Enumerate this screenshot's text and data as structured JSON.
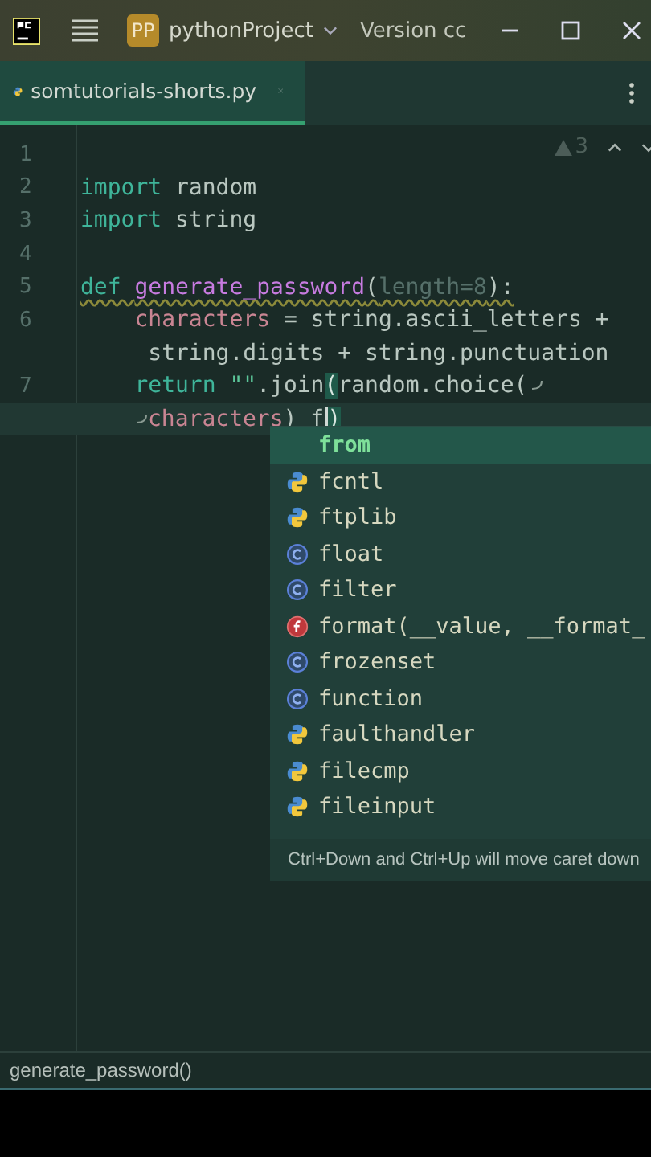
{
  "title_bar": {
    "project_badge": "PP",
    "project": "pythonProject",
    "vcs": "Version cc"
  },
  "tabs": [
    {
      "label": "somtutorials-shorts.py",
      "selected": true
    }
  ],
  "inspections": {
    "count": "3"
  },
  "code_lines": [
    {
      "number": "1"
    },
    {
      "number": "2",
      "segments": [
        {
          "kind": "keyword",
          "text": "import"
        },
        {
          "kind": "plain",
          "text": " random"
        }
      ]
    },
    {
      "number": "3",
      "segments": [
        {
          "kind": "keyword",
          "text": "import"
        },
        {
          "kind": "plain",
          "text": " string"
        }
      ]
    },
    {
      "number": "4"
    },
    {
      "number": "5",
      "warning": true,
      "segments": [
        {
          "kind": "keyword",
          "text": "def "
        },
        {
          "kind": "function",
          "text": "generate_password"
        },
        {
          "kind": "plain",
          "text": "("
        },
        {
          "kind": "param",
          "text": "length=8"
        },
        {
          "kind": "plain",
          "text": "):"
        }
      ]
    },
    {
      "number": "6",
      "segments": [
        {
          "kind": "variable",
          "text": "    characters"
        },
        {
          "kind": "plain",
          "text": " = string.ascii_letters +"
        }
      ]
    },
    {
      "segments": [
        {
          "kind": "plain",
          "text": "     string.digits + string.punctuation"
        }
      ]
    },
    {
      "number": "7",
      "wrapped": true,
      "segments": [
        {
          "kind": "keyword",
          "text": "    return"
        },
        {
          "kind": "string",
          "text": " \"\""
        },
        {
          "kind": "plain",
          "text": ".join"
        },
        {
          "kind": "brace-match",
          "text": "("
        },
        {
          "kind": "plain",
          "text": "random.choice("
        }
      ]
    },
    {
      "continued": true,
      "current": true,
      "segments": [
        {
          "kind": "variable",
          "text": "characters"
        },
        {
          "kind": "plain",
          "text": ") f"
        },
        {
          "kind": "caret"
        },
        {
          "kind": "brace-match",
          "text": ")"
        }
      ]
    }
  ],
  "completion": {
    "items": [
      {
        "kind": "keyword",
        "label": "from",
        "selected": true
      },
      {
        "kind": "module",
        "label": "fcntl",
        "selected": false
      },
      {
        "kind": "module",
        "label": "ftplib",
        "selected": false
      },
      {
        "kind": "class",
        "label": "float",
        "selected": false
      },
      {
        "kind": "class",
        "label": "filter",
        "selected": false
      },
      {
        "kind": "function",
        "label": "format(__value, __format_",
        "selected": false
      },
      {
        "kind": "class",
        "label": "frozenset",
        "selected": false
      },
      {
        "kind": "class",
        "label": "function",
        "selected": false
      },
      {
        "kind": "module",
        "label": "faulthandler",
        "selected": false
      },
      {
        "kind": "module",
        "label": "filecmp",
        "selected": false
      },
      {
        "kind": "module",
        "label": "fileinput",
        "selected": false
      }
    ],
    "hint": "Ctrl+Down and Ctrl+Up will move caret down"
  },
  "breadcrumb": "generate_password()"
}
